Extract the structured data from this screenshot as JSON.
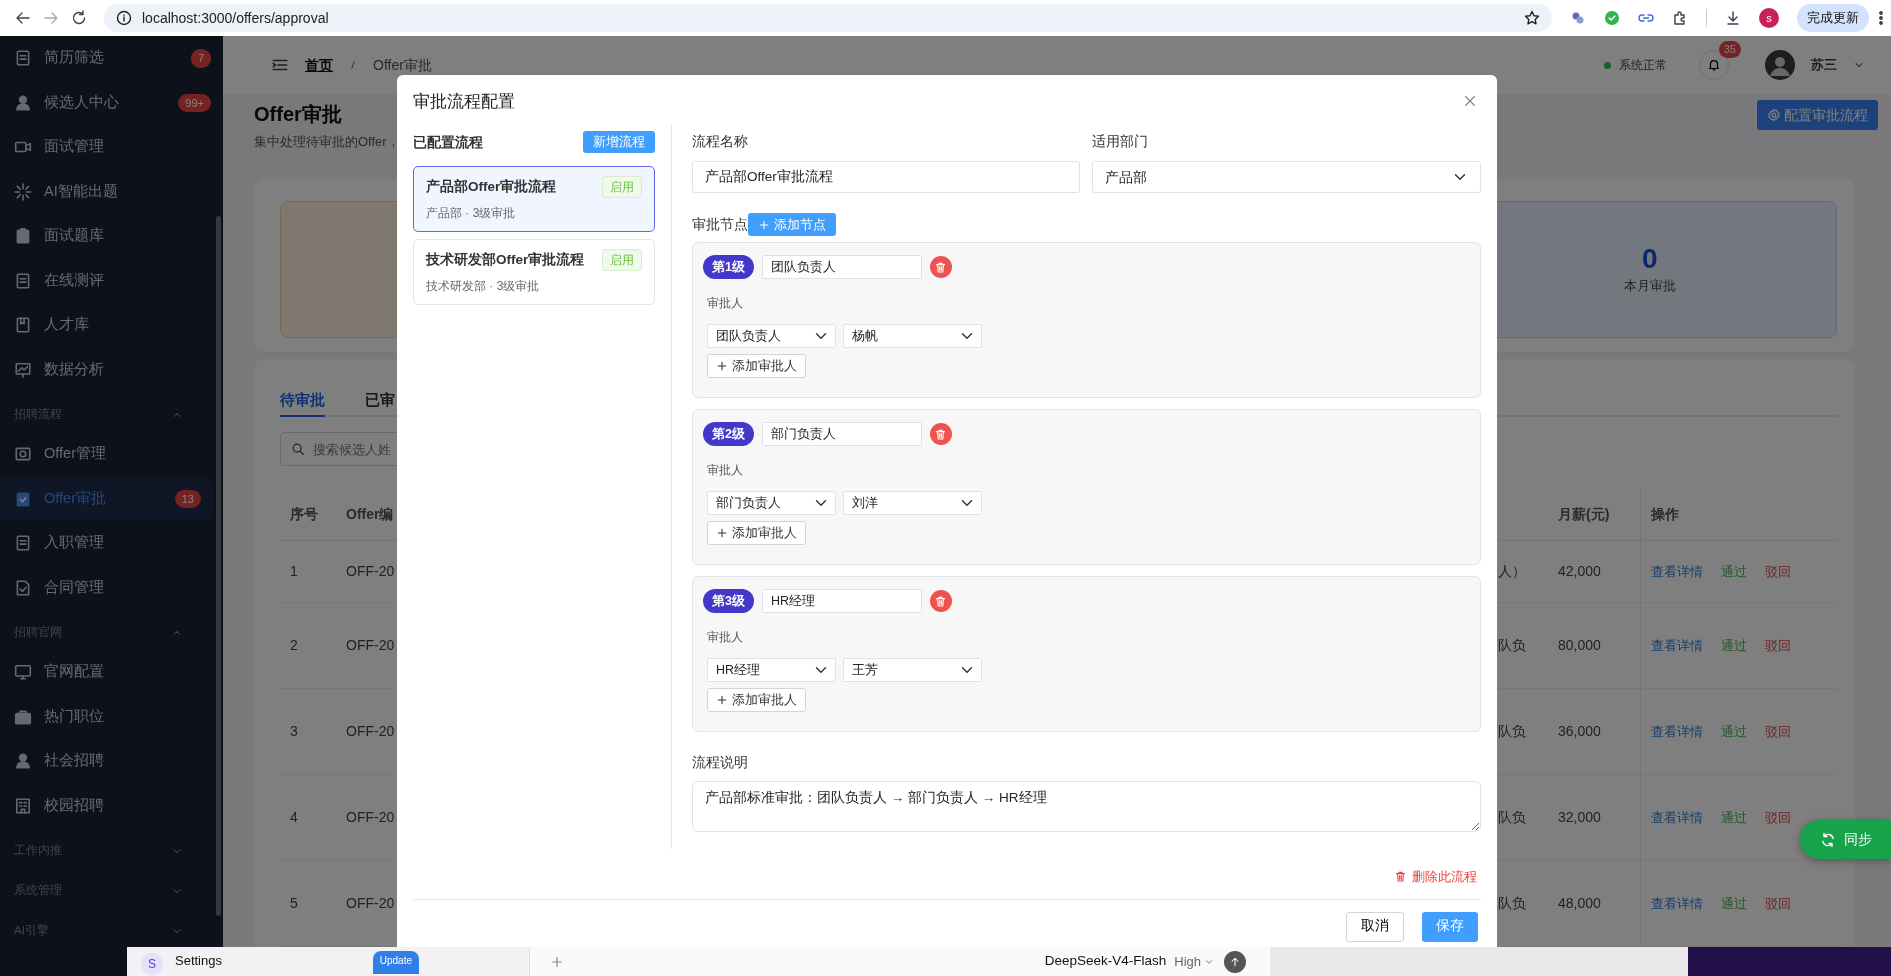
{
  "browser": {
    "url": "localhost:3000/offers/approval",
    "profile_initial": "s",
    "update_button": "完成更新"
  },
  "sidebar": {
    "items": [
      {
        "kind": "item",
        "label": "简历筛选",
        "badge": "7",
        "selected": false
      },
      {
        "kind": "item",
        "label": "候选人中心",
        "badge": "99+",
        "selected": false
      },
      {
        "kind": "item",
        "label": "面试管理",
        "selected": false
      },
      {
        "kind": "item",
        "label": "AI智能出题",
        "selected": false
      },
      {
        "kind": "item",
        "label": "面试题库",
        "selected": false
      },
      {
        "kind": "item",
        "label": "在线测评",
        "selected": false
      },
      {
        "kind": "item",
        "label": "人才库",
        "selected": false
      },
      {
        "kind": "item",
        "label": "数据分析",
        "selected": false
      },
      {
        "kind": "section",
        "label": "招聘流程",
        "expanded": true
      },
      {
        "kind": "item",
        "label": "Offer管理",
        "selected": false
      },
      {
        "kind": "item",
        "label": "Offer审批",
        "badge": "13",
        "selected": true
      },
      {
        "kind": "item",
        "label": "入职管理",
        "selected": false
      },
      {
        "kind": "item",
        "label": "合同管理",
        "selected": false
      },
      {
        "kind": "section",
        "label": "招聘官网",
        "expanded": true
      },
      {
        "kind": "item",
        "label": "官网配置",
        "selected": false
      },
      {
        "kind": "item",
        "label": "热门职位",
        "selected": false
      },
      {
        "kind": "item",
        "label": "社会招聘",
        "selected": false
      },
      {
        "kind": "item",
        "label": "校园招聘",
        "selected": false
      },
      {
        "kind": "section",
        "label": "工作内推",
        "expanded": false
      },
      {
        "kind": "section",
        "label": "系统管理",
        "expanded": false
      },
      {
        "kind": "section",
        "label": "AI引擎",
        "expanded": false
      }
    ]
  },
  "header": {
    "breadcrumb": [
      "首页",
      "Offer审批"
    ],
    "status": "系统正常",
    "notifications": "35",
    "user": "苏三"
  },
  "page": {
    "title": "Offer审批",
    "subtitle": "集中处理待审批的Offer，",
    "config_button": "配置审批流程",
    "stats": [
      {
        "kind": "warm"
      },
      {
        "kind": "info",
        "value": "0",
        "label": "本月审批"
      }
    ],
    "tabs": [
      {
        "label": "待审批",
        "selected": true
      },
      {
        "label": "已审",
        "selected": false
      }
    ],
    "search": {
      "placeholder": "搜索候选人姓"
    },
    "table": {
      "columns": [
        "序号",
        "Offer编",
        "月薪(元)",
        "操作"
      ],
      "rows": [
        {
          "index": "1",
          "offer_no": "OFF-20",
          "column_3": "人）",
          "salary": "42,000",
          "actions": [
            {
              "kind": "view",
              "label": "查看详情"
            },
            {
              "kind": "approve",
              "label": "通过"
            },
            {
              "kind": "reject",
              "label": "驳回"
            }
          ]
        },
        {
          "index": "2",
          "offer_no": "OFF-20",
          "column_3": "队负",
          "salary": "80,000",
          "actions": [
            {
              "kind": "view",
              "label": "查看详情"
            },
            {
              "kind": "approve",
              "label": "通过"
            },
            {
              "kind": "reject",
              "label": "驳回"
            }
          ]
        },
        {
          "index": "3",
          "offer_no": "OFF-20",
          "column_3": "队负",
          "salary": "36,000",
          "actions": [
            {
              "kind": "view",
              "label": "查看详情"
            },
            {
              "kind": "approve",
              "label": "通过"
            },
            {
              "kind": "reject",
              "label": "驳回"
            }
          ]
        },
        {
          "index": "4",
          "offer_no": "OFF-20",
          "column_3": "队负",
          "salary": "32,000",
          "actions": [
            {
              "kind": "view",
              "label": "查看详情"
            },
            {
              "kind": "approve",
              "label": "通过"
            },
            {
              "kind": "reject",
              "label": "驳回"
            }
          ]
        },
        {
          "index": "5",
          "offer_no": "OFF-20",
          "column_3": "队负",
          "salary": "48,000",
          "actions": [
            {
              "kind": "view",
              "label": "查看详情"
            },
            {
              "kind": "approve",
              "label": "通过"
            },
            {
              "kind": "reject",
              "label": "驳回"
            }
          ]
        }
      ]
    },
    "sync_button": "同步"
  },
  "modal": {
    "title": "审批流程配置",
    "flows_heading": "已配置流程",
    "add_flow": "新增流程",
    "flows": [
      {
        "name": "产品部Offer审批流程",
        "meta": "产品部 · 3级审批",
        "status": "启用",
        "selected": true
      },
      {
        "name": "技术研发部Offer审批流程",
        "meta": "技术研发部 · 3级审批",
        "status": "启用",
        "selected": false
      }
    ],
    "name_label": "流程名称",
    "name_value": "产品部Offer审批流程",
    "dept_label": "适用部门",
    "dept_value": "产品部",
    "nodes_label": "审批节点",
    "add_node": "添加节点",
    "nodes": [
      {
        "level": "第1级",
        "name": "团队负责人",
        "approver_label": "审批人",
        "approvers": [
          {
            "role": "团队负责人",
            "person": "杨帆"
          }
        ],
        "add_approver": "添加审批人"
      },
      {
        "level": "第2级",
        "name": "部门负责人",
        "approver_label": "审批人",
        "approvers": [
          {
            "role": "部门负责人",
            "person": "刘洋"
          }
        ],
        "add_approver": "添加审批人"
      },
      {
        "level": "第3级",
        "name": "HR经理",
        "approver_label": "审批人",
        "approvers": [
          {
            "role": "HR经理",
            "person": "王芳"
          }
        ],
        "add_approver": "添加审批人"
      }
    ],
    "desc_label": "流程说明",
    "desc_value": "产品部标准审批：团队负责人 → 部门负责人 → HR经理",
    "delete": "删除此流程",
    "cancel": "取消",
    "save": "保存"
  },
  "taskbar": {
    "app_initial": "S",
    "app_title": "Settings",
    "update": "Update",
    "model": "DeepSeek-V4-Flash",
    "effort": "High"
  }
}
